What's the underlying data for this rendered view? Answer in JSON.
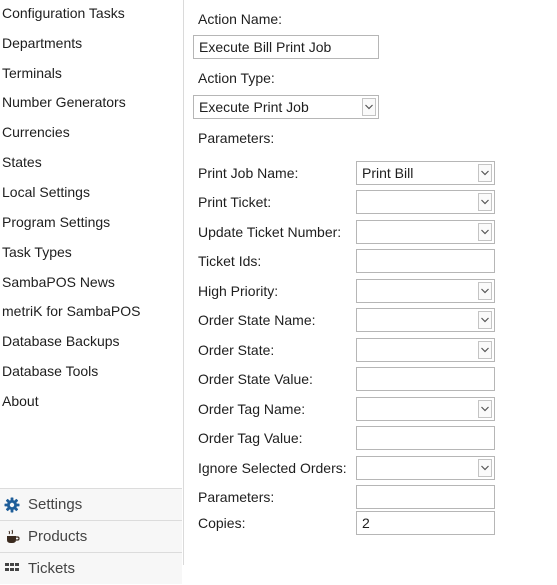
{
  "sidebar": {
    "items": [
      {
        "label": "Configuration Tasks"
      },
      {
        "label": "Departments"
      },
      {
        "label": "Terminals"
      },
      {
        "label": "Number Generators"
      },
      {
        "label": "Currencies"
      },
      {
        "label": "States"
      },
      {
        "label": "Local Settings"
      },
      {
        "label": "Program Settings"
      },
      {
        "label": "Task Types"
      },
      {
        "label": "SambaPOS News"
      },
      {
        "label": "metriK for SambaPOS"
      },
      {
        "label": "Database Backups"
      },
      {
        "label": "Database Tools"
      },
      {
        "label": "About"
      }
    ],
    "bottom_nav": [
      {
        "label": "Settings",
        "icon": "gear-icon",
        "color": "#1f5e99"
      },
      {
        "label": "Products",
        "icon": "coffee-cup-icon",
        "color": "#3a2a1e"
      },
      {
        "label": "Tickets",
        "icon": "grid-icon",
        "color": "#444444"
      }
    ]
  },
  "form": {
    "action_name": {
      "label": "Action Name:",
      "value": "Execute Bill Print Job"
    },
    "action_type": {
      "label": "Action Type:",
      "value": "Execute Print Job"
    },
    "parameters_header": "Parameters:",
    "params": [
      {
        "label": "Print Job Name:",
        "value": "Print Bill",
        "kind": "dropdown"
      },
      {
        "label": "Print Ticket:",
        "value": "",
        "kind": "dropdown"
      },
      {
        "label": "Update Ticket Number:",
        "value": "",
        "kind": "dropdown"
      },
      {
        "label": "Ticket Ids:",
        "value": "",
        "kind": "text"
      },
      {
        "label": "High Priority:",
        "value": "",
        "kind": "dropdown"
      },
      {
        "label": "Order State Name:",
        "value": "",
        "kind": "dropdown"
      },
      {
        "label": "Order State:",
        "value": "",
        "kind": "dropdown"
      },
      {
        "label": "Order State Value:",
        "value": "",
        "kind": "text"
      },
      {
        "label": "Order Tag Name:",
        "value": "",
        "kind": "dropdown"
      },
      {
        "label": "Order Tag Value:",
        "value": "",
        "kind": "text"
      },
      {
        "label": "Ignore Selected Orders:",
        "value": "",
        "kind": "dropdown"
      },
      {
        "label": "Parameters:",
        "value": "",
        "kind": "text"
      },
      {
        "label": "Copies:",
        "value": "2",
        "kind": "text"
      }
    ]
  },
  "colors": {
    "sidebar_divider": "#dadada",
    "input_border": "#b6b6b6",
    "text": "#1e1e1e"
  }
}
